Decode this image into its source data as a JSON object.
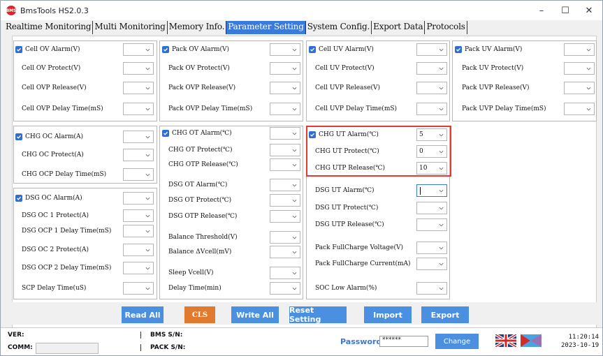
{
  "window": {
    "title": "BmsTools HS2.0.3",
    "logo_text": "BMS",
    "min": "–",
    "max": "☐",
    "close": "✕"
  },
  "tabs": [
    "Realtime Monitoring",
    "Multi Monitoring",
    "Memory Info.",
    "Parameter Setting",
    "System Config.",
    "Export Data",
    "Protocols"
  ],
  "params": {
    "cell_ov_alarm": "Cell OV Alarm(V)",
    "cell_ov_protect": "Cell OV Protect(V)",
    "cell_ovp_release": "Cell OVP Release(V)",
    "cell_ovp_delay": "Cell OVP Delay Time(mS)",
    "pack_ov_alarm": "Pack OV Alarm(V)",
    "pack_ov_protect": "Pack OV Protect(V)",
    "pack_ovp_release": "Pack OVP Release(V)",
    "pack_ovp_delay": "Pack OVP Delay Time(mS)",
    "cell_uv_alarm": "Cell UV Alarm(V)",
    "cell_uv_protect": "Cell UV Protect(V)",
    "cell_uvp_release": "Cell UVP Release(V)",
    "cell_uvp_delay": "Cell UVP Delay Time(mS)",
    "pack_uv_alarm": "Pack UV Alarm(V)",
    "pack_uv_protect": "Pack UV Protect(V)",
    "pack_uvp_release": "Pack UVP Release(V)",
    "pack_uvp_delay": "Pack UVP Delay Time(mS)",
    "chg_oc_alarm": "CHG OC Alarm(A)",
    "chg_oc_protect": "CHG OC Protect(A)",
    "chg_ocp_delay": "CHG OCP Delay Time(mS)",
    "dsg_oc_alarm": "DSG OC Alarm(A)",
    "dsg_oc1_protect": "DSG OC 1 Protect(A)",
    "dsg_ocp1_delay": "DSG OCP 1 Delay Time(mS)",
    "dsg_oc2_protect": "DSG OC 2 Protect(A)",
    "dsg_ocp2_delay": "DSG OCP 2 Delay Time(mS)",
    "scp_delay": "SCP Delay Time(uS)",
    "chg_ot_alarm": "CHG OT Alarm(℃)",
    "chg_ot_protect": "CHG OT Protect(℃)",
    "chg_otp_release": "CHG OTP Release(℃)",
    "dsg_ot_alarm": "DSG OT Alarm(℃)",
    "dsg_ot_protect": "DSG OT Protect(℃)",
    "dsg_otp_release": "DSG OTP Release(℃)",
    "balance_threshold": "Balance Threshold(V)",
    "balance_dvcell": "Balance ΔVcell(mV)",
    "sleep_vcell": "Sleep Vcell(V)",
    "delay_time": "Delay Time(min)",
    "chg_ut_alarm": "CHG UT Alarm(℃)",
    "chg_ut_protect": "CHG UT Protect(℃)",
    "chg_utp_release": "CHG UTP Release(℃)",
    "dsg_ut_alarm": "DSG UT Alarm(℃)",
    "dsg_ut_protect": "DSG UT Protect(℃)",
    "dsg_utp_release": "DSG UTP Release(℃)",
    "pack_fullcharge_voltage": "Pack FullCharge Voltage(V)",
    "pack_fullcharge_current": "Pack FullCharge Current(mA)",
    "soc_low_alarm": "SOC Low Alarm(%)"
  },
  "values": {
    "chg_ut_alarm": "5",
    "chg_ut_protect": "0",
    "chg_utp_release": "10"
  },
  "buttons": {
    "read_all": "Read All",
    "cls": "CLS",
    "write_all": "Write All",
    "reset_setting": "Reset Setting",
    "import": "Import",
    "export": "Export",
    "change": "Change"
  },
  "status": {
    "ver_label": "VER:",
    "comm_label": "COMM:",
    "bms_sn_label": "BMS S/N:",
    "pack_sn_label": "PACK S/N:",
    "password_label": "Password",
    "password_value": "******",
    "time": "11:20:14",
    "date": "2023-10-19"
  },
  "colors": {
    "accent": "#3a7ad9",
    "button": "#4a8fe0",
    "cls_button": "#e07a2f",
    "highlight": "#e53935",
    "checkbox": "#2f6fd1"
  }
}
